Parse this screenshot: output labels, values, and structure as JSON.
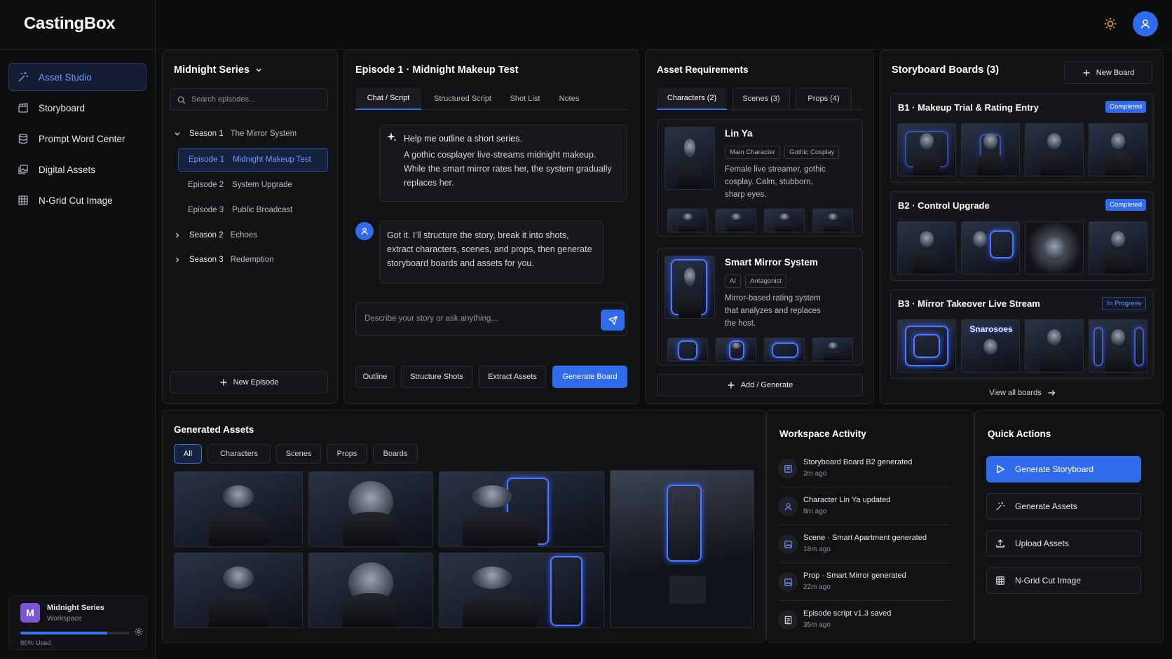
{
  "app": {
    "title": "CastingBox"
  },
  "colors": {
    "accent": "#2f6bea",
    "accent_text": "#6f97ff",
    "background": "#0c0d0f",
    "panel": "#111214",
    "completed": "#2f6bea",
    "in_progress": "#6f97ff",
    "workspace_avatar": "#7c55d6",
    "theme_icon": "#e8a532"
  },
  "nav": {
    "items": [
      {
        "label": "Asset Studio",
        "icon": "magic-wand-icon",
        "active": true
      },
      {
        "label": "Storyboard",
        "icon": "clapperboard-icon",
        "active": false
      },
      {
        "label": "Prompt Word Center",
        "icon": "database-icon",
        "active": false
      },
      {
        "label": "Digital Assets",
        "icon": "image-stack-icon",
        "active": false
      },
      {
        "label": "N-Grid Cut Image",
        "icon": "grid-icon",
        "active": false
      }
    ]
  },
  "workspace": {
    "initial": "M",
    "name": "Midnight Series",
    "sub": "Workspace",
    "used_label": "80% Used",
    "used_fraction": 0.8
  },
  "topbar": {
    "theme_icon": "sun-icon",
    "avatar_icon": "user-icon"
  },
  "series": {
    "title": "Midnight Series",
    "search_placeholder": "Search episodes...",
    "seasons": [
      {
        "label": "Season 1",
        "name": "The Mirror System",
        "expanded": true,
        "episodes": [
          {
            "label": "Episode 1",
            "name": "Midnight Makeup Test",
            "active": true
          },
          {
            "label": "Episode 2",
            "name": "System Upgrade",
            "active": false
          },
          {
            "label": "Episode 3",
            "name": "Public Broadcast",
            "active": false
          }
        ]
      },
      {
        "label": "Season 2",
        "name": "Echoes",
        "expanded": false
      },
      {
        "label": "Season 3",
        "name": "Redemption",
        "expanded": false
      }
    ],
    "new_episode_label": "New Episode"
  },
  "episode": {
    "title": "Episode 1 · Midnight Makeup Test",
    "tabs": [
      {
        "label": "Chat / Script",
        "active": true
      },
      {
        "label": "Structured Script",
        "active": false
      },
      {
        "label": "Shot List",
        "active": false
      },
      {
        "label": "Notes",
        "active": false
      }
    ],
    "user_prompt_title": "Help me outline a short series.",
    "user_prompt_body": "A gothic cosplayer live-streams midnight makeup. While the smart mirror rates her, the system gradually replaces her.",
    "assistant_reply": "Got it. I’ll structure the story, break it into shots, extract characters, scenes, and props, then generate storyboard boards and assets for you.",
    "input_placeholder": "Describe your story or ask anything...",
    "actions": [
      "Outline",
      "Structure Shots",
      "Extract Assets",
      "Generate Board"
    ]
  },
  "requirements": {
    "title": "Asset Requirements",
    "tabs": [
      {
        "label": "Characters (2)",
        "active": true
      },
      {
        "label": "Scenes (3)",
        "active": false
      },
      {
        "label": "Props (4)",
        "active": false
      }
    ],
    "items": [
      {
        "name": "Lin Ya",
        "tags": [
          "Main Character",
          "Gothic Cosplay"
        ],
        "desc_lines": [
          "Female live streamer, gothic",
          "cosplay. Calm, stubborn,",
          "sharp eyes."
        ]
      },
      {
        "name": "Smart Mirror System",
        "tags": [
          "AI",
          "Antagonist"
        ],
        "desc_lines": [
          "Mirror-based rating system",
          "that analyzes and replaces",
          "the host."
        ]
      }
    ],
    "add_label": "Add / Generate"
  },
  "boards": {
    "title": "Storyboard Boards (3)",
    "new_label": "New Board",
    "items": [
      {
        "title": "B1 · Makeup Trial & Rating Entry",
        "status": "Completed"
      },
      {
        "title": "B2 · Control Upgrade",
        "status": "Completed"
      },
      {
        "title": "B3 · Mirror Takeover Live Stream",
        "status": "In Progress",
        "frame_text": "Snarosoes"
      }
    ],
    "view_all_label": "View all boards"
  },
  "generated": {
    "title": "Generated Assets",
    "filters": [
      {
        "label": "All",
        "active": true
      },
      {
        "label": "Characters",
        "active": false
      },
      {
        "label": "Scenes",
        "active": false
      },
      {
        "label": "Props",
        "active": false
      },
      {
        "label": "Boards",
        "active": false
      }
    ]
  },
  "activity": {
    "title": "Workspace Activity",
    "items": [
      {
        "text": "Storyboard Board B2 generated",
        "time": "2m ago",
        "icon": "board-icon"
      },
      {
        "text": "Character Lin Ya updated",
        "time": "8m ago",
        "icon": "user-icon"
      },
      {
        "text": "Scene · Smart Apartment generated",
        "time": "18m ago",
        "icon": "image-icon"
      },
      {
        "text": "Prop · Smart Mirror generated",
        "time": "22m ago",
        "icon": "image-icon"
      },
      {
        "text": "Episode script v1.3 saved",
        "time": "35m ago",
        "icon": "document-icon"
      }
    ]
  },
  "quick_actions": {
    "title": "Quick Actions",
    "items": [
      {
        "label": "Generate Storyboard",
        "icon": "play-icon",
        "primary": true
      },
      {
        "label": "Generate Assets",
        "icon": "magic-wand-icon",
        "primary": false
      },
      {
        "label": "Upload Assets",
        "icon": "upload-icon",
        "primary": false
      },
      {
        "label": "N-Grid Cut Image",
        "icon": "grid-icon",
        "primary": false
      }
    ]
  }
}
